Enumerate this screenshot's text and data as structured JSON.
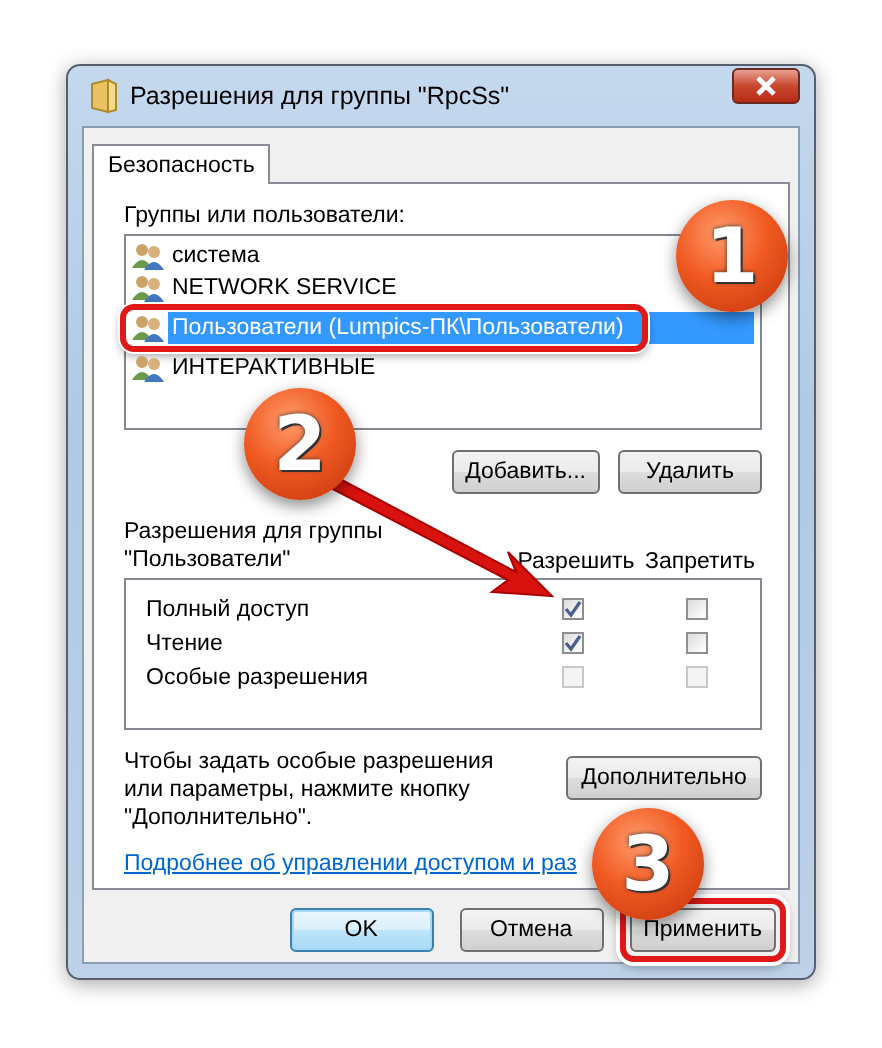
{
  "window": {
    "title": "Разрешения для группы \"RpcSs\""
  },
  "tabs": [
    {
      "label": "Безопасность",
      "selected": true
    }
  ],
  "groups_label": "Группы или пользователи:",
  "users": [
    {
      "name": "система",
      "selected": false
    },
    {
      "name": "NETWORK SERVICE",
      "selected": false
    },
    {
      "name": "Пользователи (Lumpics-ПК\\Пользователи)",
      "selected": true
    },
    {
      "name": "ИНТЕРАКТИВНЫЕ",
      "selected": false
    }
  ],
  "user_buttons": [
    "Добавить...",
    "Удалить"
  ],
  "permissions": {
    "label": "Разрешения для группы\n\"Пользователи\"",
    "allow_header": "Разрешить",
    "deny_header": "Запретить",
    "rows": [
      {
        "name": "Полный доступ",
        "allow": true,
        "deny": false,
        "disabled": false
      },
      {
        "name": "Чтение",
        "allow": true,
        "deny": false,
        "disabled": false
      },
      {
        "name": "Особые разрешения",
        "allow": false,
        "deny": false,
        "disabled": true
      }
    ]
  },
  "advanced_text": "Чтобы задать особые разрешения или параметры, нажмите кнопку \"Дополнительно\".",
  "advanced_button": "Дополнительно",
  "link": "Подробнее об управлении доступом и раз",
  "buttons": [
    {
      "label": "OK",
      "kind": "default",
      "highlighted": false
    },
    {
      "label": "Отмена",
      "kind": "normal",
      "highlighted": false
    },
    {
      "label": "Применить",
      "kind": "normal",
      "highlighted": true
    }
  ],
  "callouts": [
    "1",
    "2",
    "3"
  ]
}
